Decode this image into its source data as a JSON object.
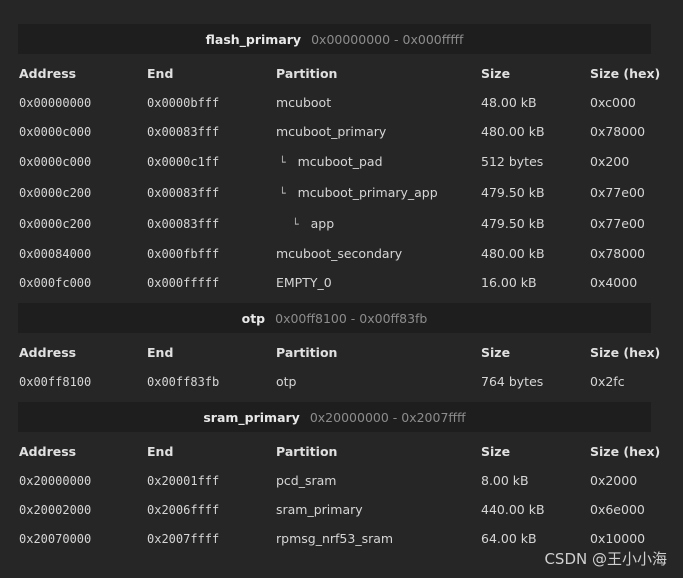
{
  "columns": {
    "address": "Address",
    "end": "End",
    "partition": "Partition",
    "size": "Size",
    "size_hex": "Size (hex)"
  },
  "regions": [
    {
      "name": "flash_primary",
      "range": "0x00000000 - 0x000fffff",
      "rows": [
        {
          "address": "0x00000000",
          "end": "0x0000bfff",
          "tree": "",
          "partition": "mcuboot",
          "size": "48.00 kB",
          "size_hex": "0xc000"
        },
        {
          "address": "0x0000c000",
          "end": "0x00083fff",
          "tree": "",
          "partition": "mcuboot_primary",
          "size": "480.00 kB",
          "size_hex": "0x78000"
        },
        {
          "address": "0x0000c000",
          "end": "0x0000c1ff",
          "tree": "└",
          "partition": "mcuboot_pad",
          "size": "512 bytes",
          "size_hex": "0x200"
        },
        {
          "address": "0x0000c200",
          "end": "0x00083fff",
          "tree": "└",
          "partition": "mcuboot_primary_app",
          "size": "479.50 kB",
          "size_hex": "0x77e00"
        },
        {
          "address": "0x0000c200",
          "end": "0x00083fff",
          "tree": "└",
          "partition": "app",
          "size": "479.50 kB",
          "size_hex": "0x77e00"
        },
        {
          "address": "0x00084000",
          "end": "0x000fbfff",
          "tree": "",
          "partition": "mcuboot_secondary",
          "size": "480.00 kB",
          "size_hex": "0x78000"
        },
        {
          "address": "0x000fc000",
          "end": "0x000fffff",
          "tree": "",
          "partition": "EMPTY_0",
          "size": "16.00 kB",
          "size_hex": "0x4000"
        }
      ]
    },
    {
      "name": "otp",
      "range": "0x00ff8100 - 0x00ff83fb",
      "rows": [
        {
          "address": "0x00ff8100",
          "end": "0x00ff83fb",
          "tree": "",
          "partition": "otp",
          "size": "764 bytes",
          "size_hex": "0x2fc"
        }
      ]
    },
    {
      "name": "sram_primary",
      "range": "0x20000000 - 0x2007ffff",
      "rows": [
        {
          "address": "0x20000000",
          "end": "0x20001fff",
          "tree": "",
          "partition": "pcd_sram",
          "size": "8.00 kB",
          "size_hex": "0x2000"
        },
        {
          "address": "0x20002000",
          "end": "0x2006ffff",
          "tree": "",
          "partition": "sram_primary",
          "size": "440.00 kB",
          "size_hex": "0x6e000"
        },
        {
          "address": "0x20070000",
          "end": "0x2007ffff",
          "tree": "",
          "partition": "rpmsg_nrf53_sram",
          "size": "64.00 kB",
          "size_hex": "0x10000"
        }
      ]
    }
  ],
  "watermark": "CSDN @王小小海"
}
